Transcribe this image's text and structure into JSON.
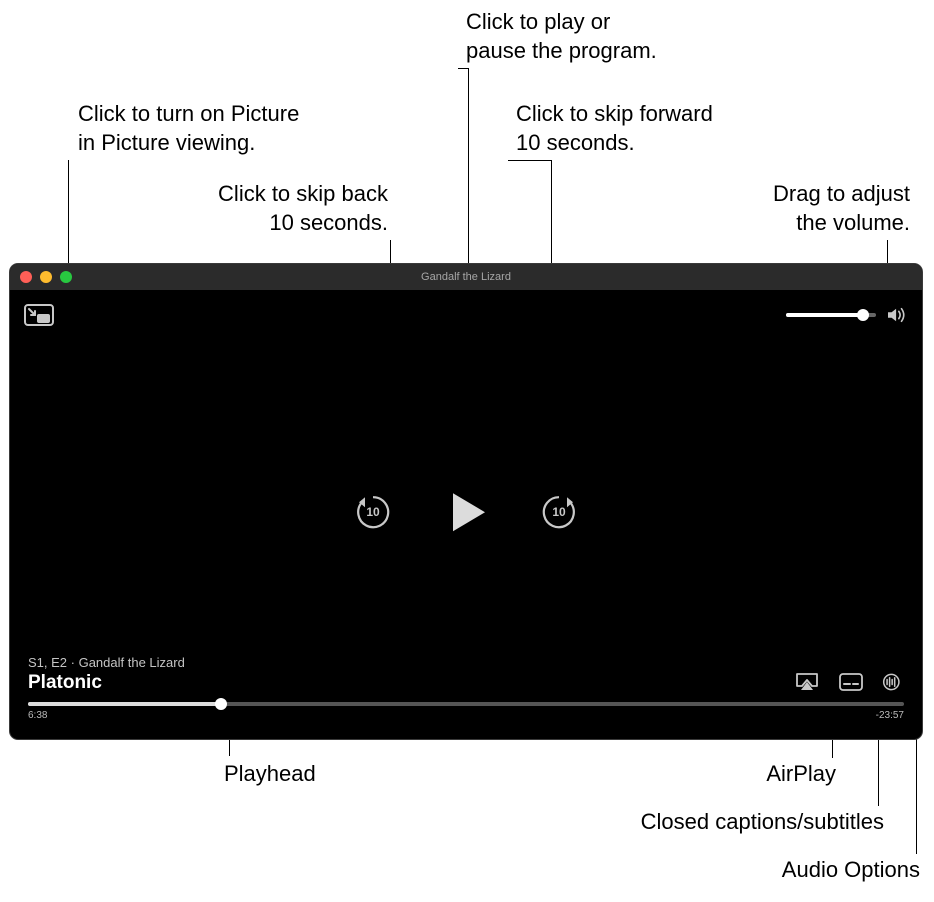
{
  "callouts": {
    "pip": "Click to turn on Picture\nin Picture viewing.",
    "skip_back": "Click to skip back\n10 seconds.",
    "play_pause": "Click to play or\npause the program.",
    "skip_forward": "Click to skip forward\n10 seconds.",
    "volume": "Drag to adjust\nthe volume.",
    "playhead": "Playhead",
    "airplay": "AirPlay",
    "captions": "Closed captions/subtitles",
    "audio_options": "Audio Options"
  },
  "window": {
    "title": "Gandalf the Lizard"
  },
  "player": {
    "skip_seconds": "10",
    "meta": "S1, E2 · Gandalf the Lizard",
    "show_title": "Platonic",
    "time_elapsed": "6:38",
    "time_remaining": "-23:57",
    "volume_percent": 85,
    "progress_percent": 22
  },
  "icons": {
    "pip": "picture-in-picture-icon",
    "skip_back": "skip-back-10-icon",
    "play": "play-icon",
    "skip_forward": "skip-forward-10-icon",
    "volume": "volume-icon",
    "airplay": "airplay-icon",
    "captions": "captions-icon",
    "audio": "audio-options-icon"
  },
  "colors": {
    "window_bg": "#000000",
    "titlebar_bg": "#2b2b2b",
    "control_grey": "#c8c8c8"
  }
}
